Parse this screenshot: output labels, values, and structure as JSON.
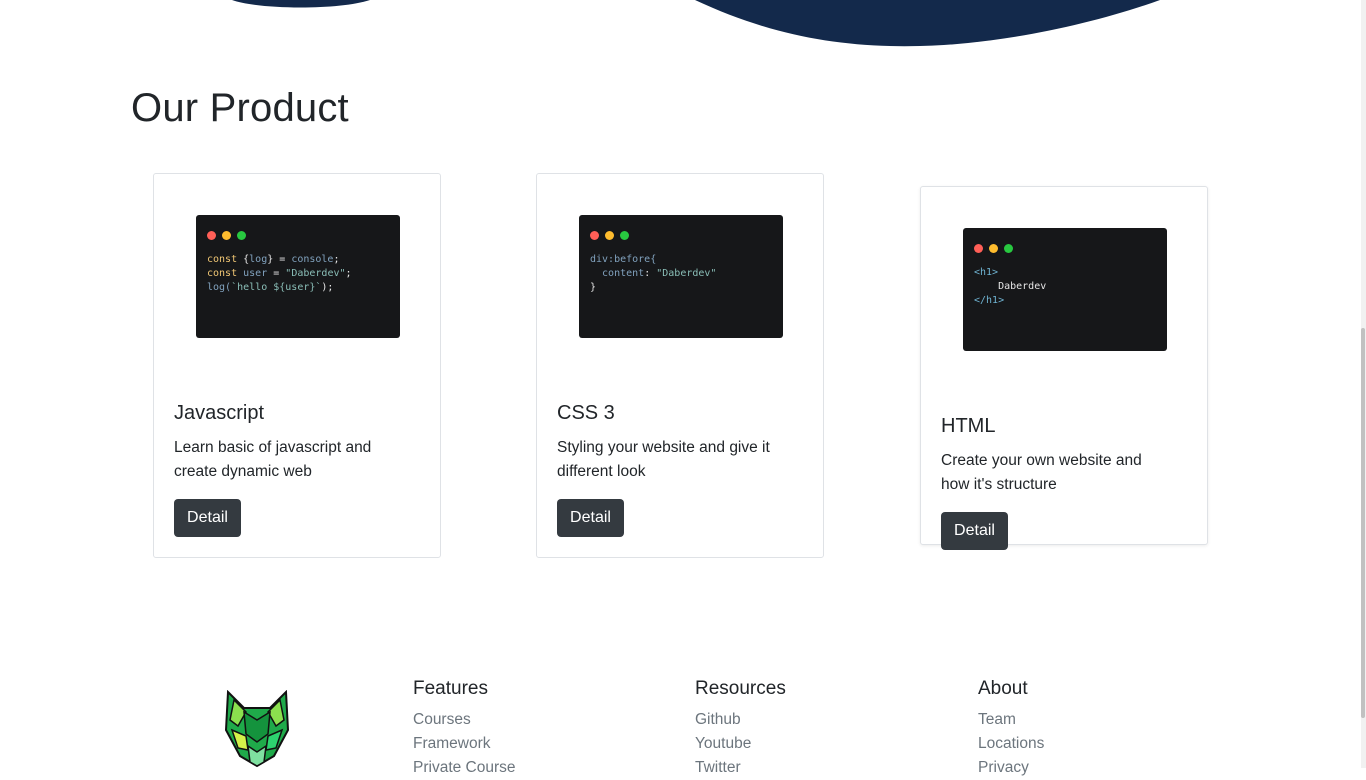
{
  "section": {
    "title": "Our Product"
  },
  "products": [
    {
      "title": "Javascript",
      "description": "Learn basic of javascript and create dynamic web",
      "button": "Detail",
      "code": {
        "line1_a": "const",
        "line1_b": " {",
        "line1_c": "log",
        "line1_d": "} = ",
        "line1_e": "console",
        "line1_f": ";",
        "line2_a": "const",
        "line2_b": " ",
        "line2_c": "user",
        "line2_d": " = ",
        "line2_e": "\"Daberdev\"",
        "line2_f": ";",
        "line3_a": "log(",
        "line3_b": "`hello ${user}`",
        "line3_c": ");"
      }
    },
    {
      "title": "CSS 3",
      "description": "Styling your website and give it different look",
      "button": "Detail",
      "code": {
        "line1": "div:before{",
        "line2_a": "  content",
        "line2_b": ": ",
        "line2_c": "\"Daberdev\"",
        "line3": "}"
      }
    },
    {
      "title": "HTML",
      "description": "Create your own website and how it's structure",
      "button": "Detail",
      "code": {
        "line1": "<h1>",
        "line2": "    Daberdev",
        "line3": "</h1>"
      }
    }
  ],
  "footer": {
    "features": {
      "title": "Features",
      "links": [
        "Courses",
        "Framework",
        "Private Course"
      ]
    },
    "resources": {
      "title": "Resources",
      "links": [
        "Github",
        "Youtube",
        "Twitter"
      ]
    },
    "about": {
      "title": "About",
      "links": [
        "Team",
        "Locations",
        "Privacy"
      ]
    }
  },
  "colors": {
    "wave": "#13294b",
    "button": "#343a40",
    "code_bg": "#161719",
    "logo_green": "#22c55e"
  },
  "icons": {
    "logo": "green-cat-mask-logo"
  }
}
